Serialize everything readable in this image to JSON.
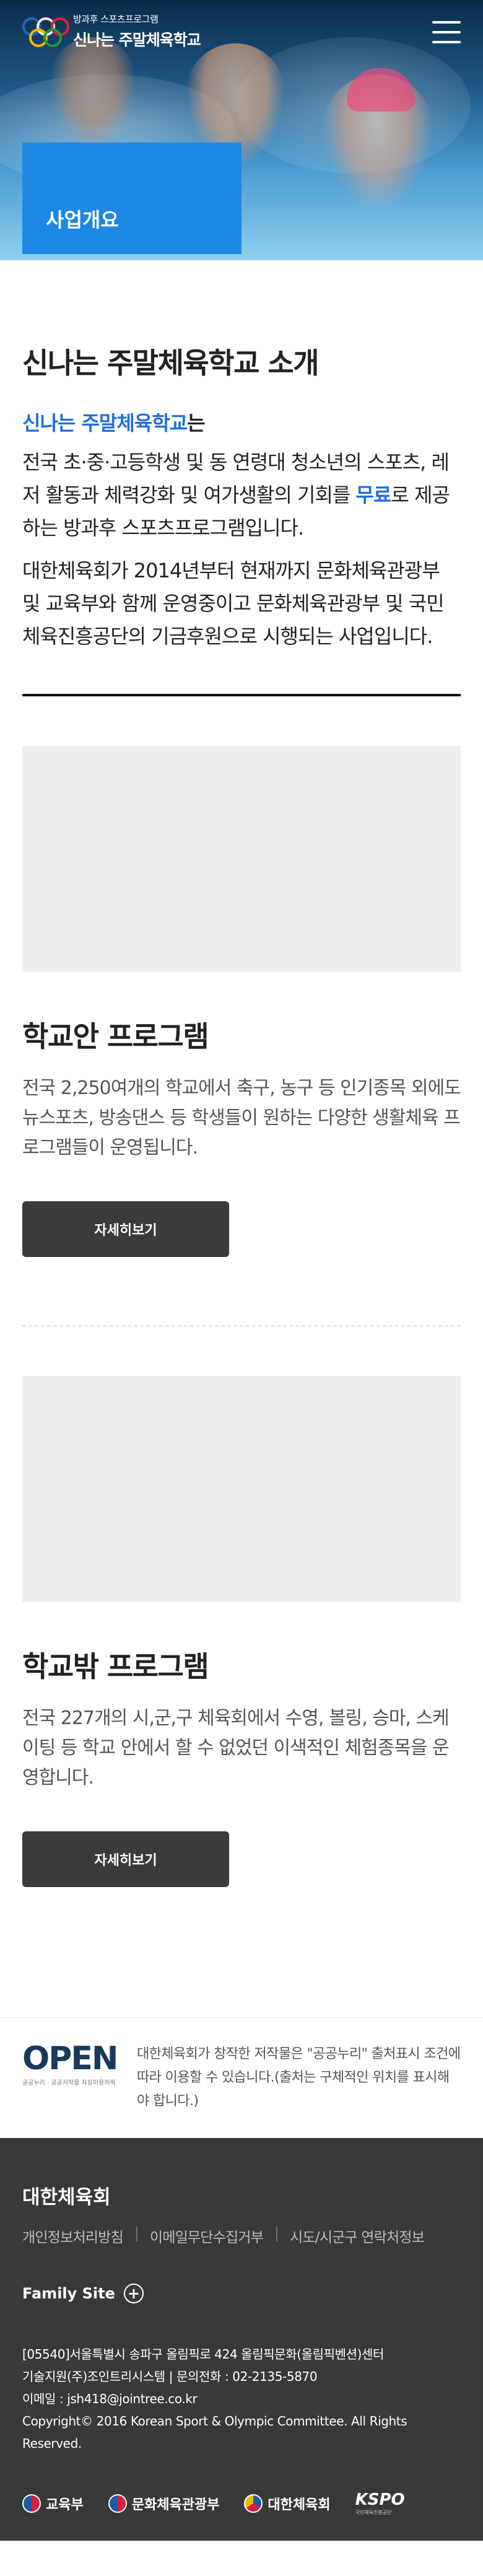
{
  "header": {
    "logo_sub": "방과후 스포츠프로그램",
    "logo_main": "신나는 주말체육학교",
    "section_label": "사업개요"
  },
  "intro": {
    "title": "신나는 주말체육학교 소개",
    "lead_highlight": "신나는 주말체육학교",
    "lead_rest": "는",
    "p1_part1": "전국 초·중·고등학생 및 동 연령대 청소년의 스포츠, 레저 활동과 체력강화 및 여가생활의 기회를 ",
    "p1_highlight": "무료",
    "p1_part2": "로 제공하는 방과후 스포츠프로그램입니다.",
    "p2": "대한체육회가 2014년부터 현재까지 문화체육관광부 및 교육부와 함께 운영중이고 문화체육관광부 및 국민체육진흥공단의 기금후원으로 시행되는 사업입니다."
  },
  "programs": [
    {
      "title": "학교안 프로그램",
      "desc": "전국 2,250여개의 학교에서 축구, 농구 등 인기종목 외에도 뉴스포츠, 방송댄스 등 학생들이 원하는 다양한 생활체육 프로그램들이 운영됩니다.",
      "button": "자세히보기"
    },
    {
      "title": "학교밖 프로그램",
      "desc": "전국 227개의 시,군,구 체육회에서 수영, 볼링, 승마, 스케이팅 등 학교 안에서 할 수 없었던 이색적인 체험종목을 운영합니다.",
      "button": "자세히보기"
    }
  ],
  "open": {
    "logo_text": "OPEN",
    "logo_tiny": "공공누리 · 공공저작물 자유이용허락",
    "text": "대한체육회가 창작한 저작물은 \"공공누리\" 출처표시 조건에 따라 이용할 수 있습니다.(출처는 구체적인 위치를 표시해야 합니다.)"
  },
  "footer": {
    "org": "대한체육회",
    "links": [
      "개인정보처리방침",
      "이메일무단수집거부",
      "시도/시군구 연락처정보"
    ],
    "family_site": "Family Site",
    "address": "[05540]서울특별시 송파구 올림픽로 424 올림픽문화(올림픽벤션)센터",
    "tech": "기술지원(주)조인트리시스템 | 문의전화 : 02-2135-5870",
    "email": "이메일 : jsh418@jointree.co.kr",
    "copyright": "Copyright© 2016 Korean Sport & Olympic Committee. All Rights Reserved.",
    "partners": [
      "교육부",
      "문화체육관광부",
      "대한체육회"
    ],
    "kspo": "KSPO",
    "kspo_sub": "국민체육진흥공단"
  }
}
